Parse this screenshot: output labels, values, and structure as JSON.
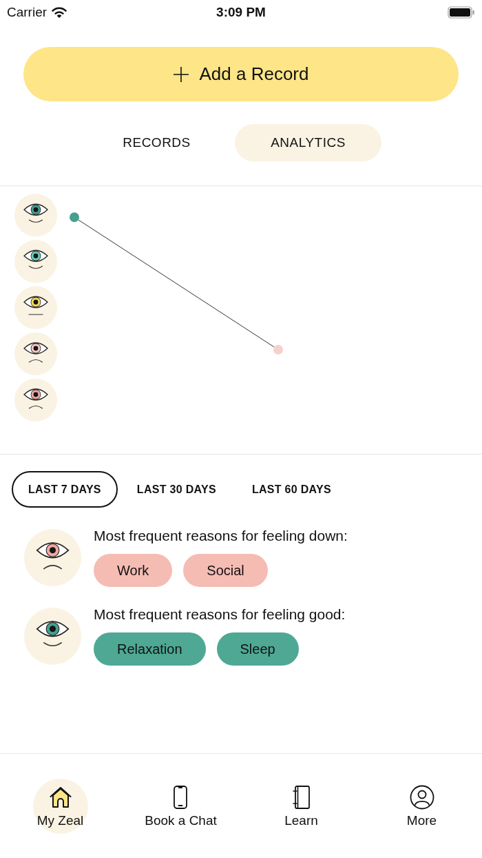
{
  "status_bar": {
    "carrier": "Carrier",
    "time": "3:09 PM"
  },
  "add_button": {
    "label": "Add a Record"
  },
  "view_tabs": [
    {
      "label": "RECORDS",
      "selected": false
    },
    {
      "label": "ANALYTICS",
      "selected": true
    }
  ],
  "mood_chart": {
    "y_axis": [
      {
        "kind": "smile",
        "color": "#45a08d"
      },
      {
        "kind": "smile",
        "color": "#62cfbb"
      },
      {
        "kind": "flat",
        "color": "#f6d75e"
      },
      {
        "kind": "frown",
        "color": "#f7c9c6"
      },
      {
        "kind": "frown",
        "color": "#f2a6a0"
      }
    ]
  },
  "range_tabs": [
    {
      "label": "LAST 7 DAYS",
      "selected": true
    },
    {
      "label": "LAST 30 DAYS",
      "selected": false
    },
    {
      "label": "LAST 60 DAYS",
      "selected": false
    }
  ],
  "reasons": [
    {
      "kind": "down",
      "title": "Most frequent reasons for feeling down:",
      "tags": [
        "Work",
        "Social"
      ]
    },
    {
      "kind": "good",
      "title": "Most frequent reasons for feeling good:",
      "tags": [
        "Relaxation",
        "Sleep"
      ]
    }
  ],
  "bottom_nav": [
    {
      "label": "My Zeal",
      "selected": true
    },
    {
      "label": "Book a Chat",
      "selected": false
    },
    {
      "label": "Learn",
      "selected": false
    },
    {
      "label": "More",
      "selected": false
    }
  ]
}
